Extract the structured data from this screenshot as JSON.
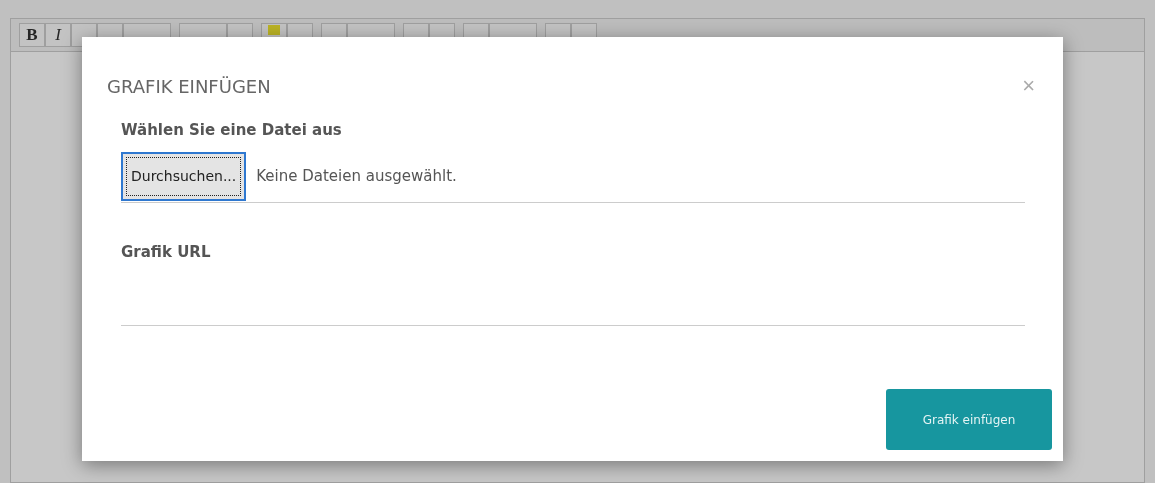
{
  "editor": {
    "toolbar": [
      {
        "label": "B",
        "kind": "bold"
      },
      {
        "label": "I",
        "kind": "italic"
      }
    ]
  },
  "dialog": {
    "title": "GRAFIK EINFÜGEN",
    "close": "×",
    "file_label": "Wählen Sie eine Datei aus",
    "file_button": "Durchsuchen...",
    "file_status": "Keine Dateien ausgewählt.",
    "url_label": "Grafik URL",
    "submit": "Grafik einfügen"
  }
}
